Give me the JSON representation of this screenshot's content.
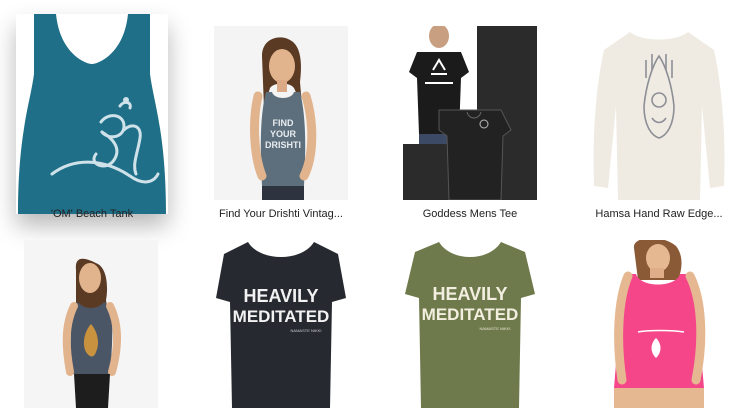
{
  "products": [
    {
      "name": "'OM' Beach Tank"
    },
    {
      "name": "Find Your Drishti Vintag..."
    },
    {
      "name": "Goddess Mens Tee"
    },
    {
      "name": "Hamsa Hand Raw Edge..."
    },
    {
      "name": ""
    },
    {
      "name": ""
    },
    {
      "name": ""
    },
    {
      "name": ""
    }
  ],
  "prints": {
    "find_your_drishti": [
      "FIND",
      "YOUR",
      "DRISHTI"
    ],
    "heavily_meditated_black": [
      "HEAVILY",
      "MEDITATED"
    ],
    "heavily_meditated_olive": [
      "HEAVILY",
      "MEDITATED"
    ],
    "namaste_tagline": "NAMASTE NIKKI"
  },
  "colors": {
    "om_tank": "#1f6f88",
    "drishti_tank": "#5d6e7c",
    "goddess_tee": "#1b1b1b",
    "hamsa_top": "#efebe2",
    "heather_tank": "#4a5666",
    "black_tee": "#262a30",
    "olive_tee": "#6f7a4c",
    "pink_tank": "#f5468a"
  }
}
